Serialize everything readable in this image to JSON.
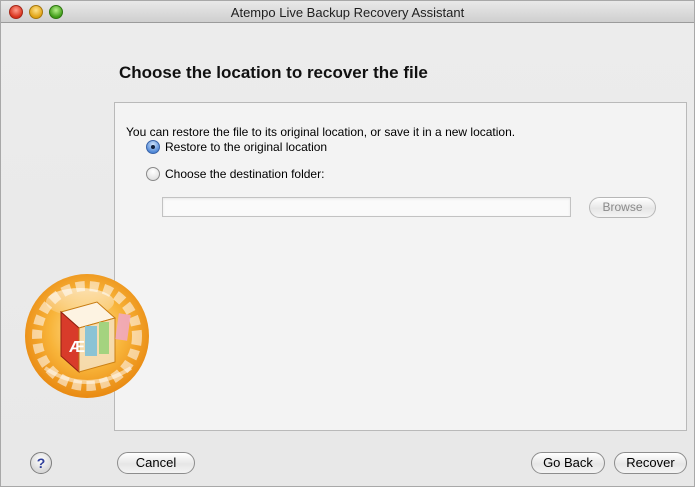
{
  "window": {
    "title": "Atempo Live Backup Recovery Assistant"
  },
  "page": {
    "heading": "Choose the location to recover the file",
    "intro": "You can restore the file to its original location, or save it in a new location."
  },
  "options": [
    {
      "label": "Restore to the original location",
      "checked": true
    },
    {
      "label": "Choose the destination folder:",
      "checked": false
    }
  ],
  "destination": {
    "path_value": "",
    "browse_label": "Browse",
    "browse_enabled": false
  },
  "footer": {
    "help_label": "?",
    "cancel_label": "Cancel",
    "goback_label": "Go Back",
    "recover_label": "Recover"
  },
  "colors": {
    "window_bg": "#ececec",
    "panel_bg": "#f3f3f3",
    "logo_orange": "#f5a623",
    "help_blue": "#2f3f9c"
  },
  "icons": {
    "logo": "atempo-live-backup-logo",
    "help": "help-icon"
  }
}
